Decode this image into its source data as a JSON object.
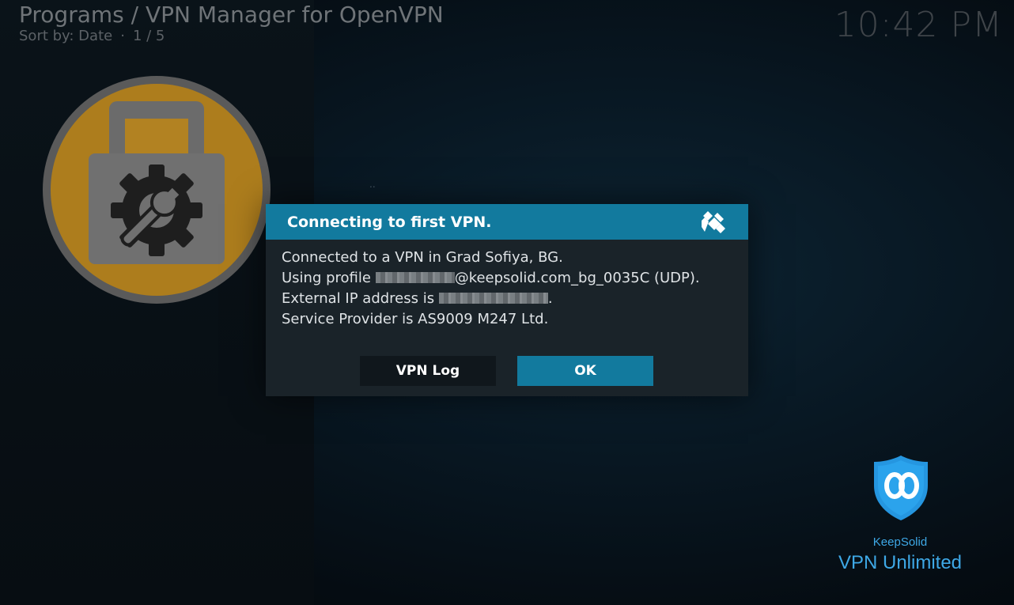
{
  "header": {
    "title": "Programs / VPN Manager for OpenVPN",
    "sort_label": "Sort by: Date",
    "separator": "·",
    "page_position": "1 / 5"
  },
  "clock": "10:42 PM",
  "addon": {
    "icon": "lock-gear-wrench-icon"
  },
  "stray_text": "..",
  "dialog": {
    "title": "Connecting to first VPN.",
    "logo": "kodi-logo-icon",
    "line1": "Connected to a VPN in Grad Sofiya, BG.",
    "line2_prefix": "Using profile ",
    "line2_suffix": "@keepsolid.com_bg_0035C (UDP).",
    "line3_prefix": "External IP address is ",
    "line3_suffix": ".",
    "line4": "Service Provider is AS9009 M247 Ltd.",
    "buttons": {
      "log": "VPN Log",
      "ok": "OK"
    }
  },
  "brand": {
    "icon": "vpn-unlimited-shield-icon",
    "company": "KeepSolid",
    "product": "VPN Unlimited"
  },
  "colors": {
    "accent": "#127a9e",
    "dialog_bg": "#1a2329",
    "brand_blue": "#3ea8e6",
    "addon_orange": "#c98a0a"
  }
}
